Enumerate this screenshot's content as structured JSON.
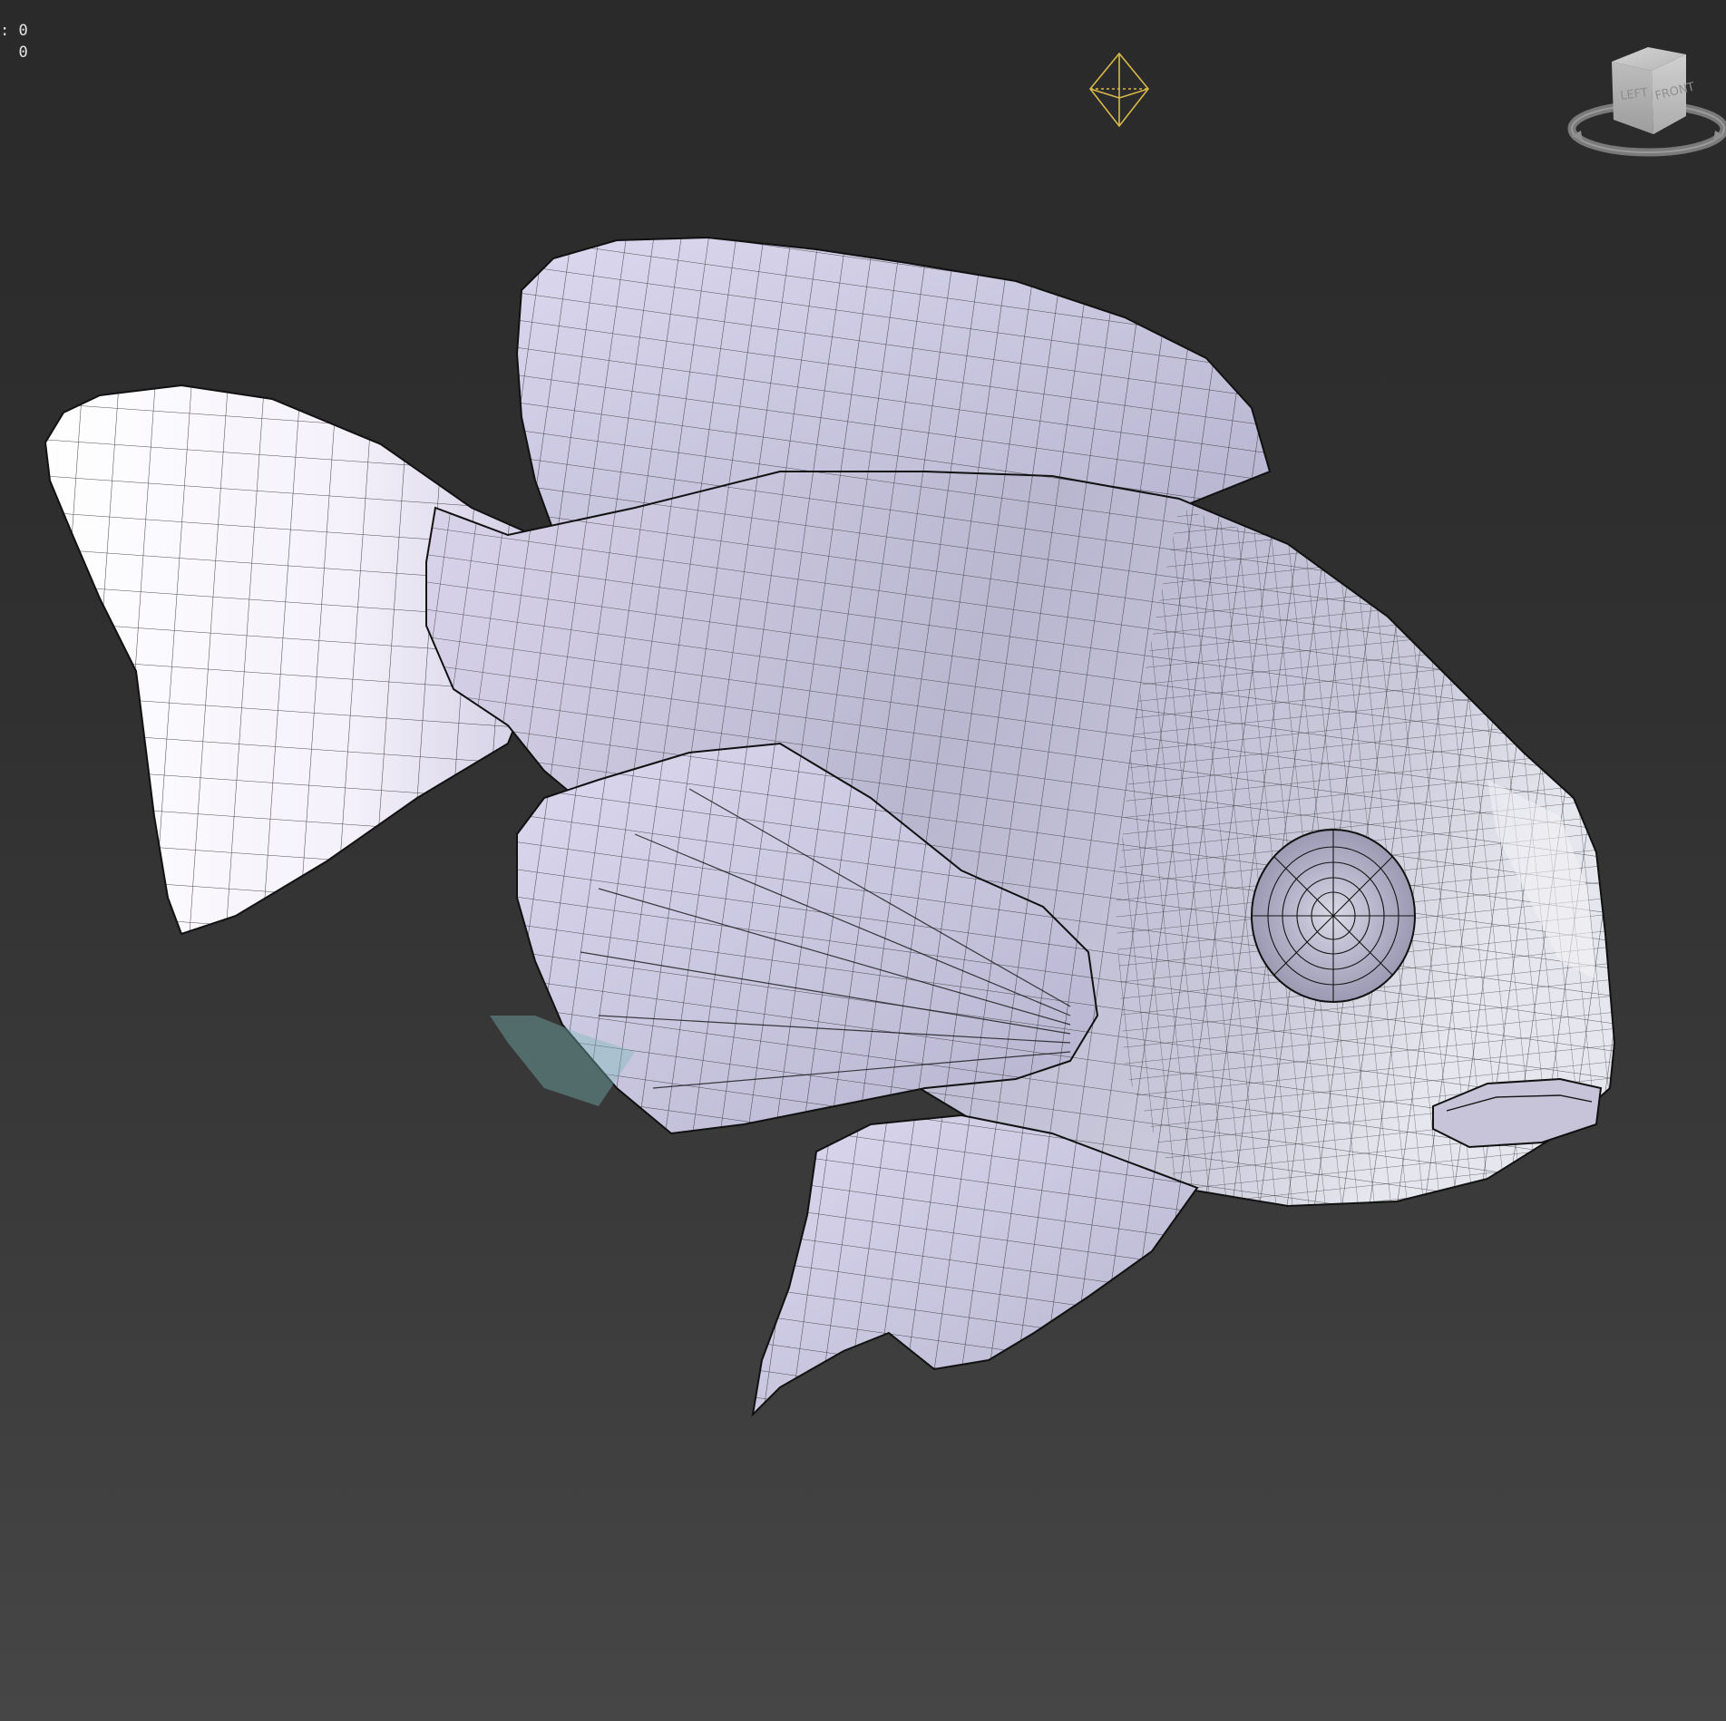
{
  "viewport": {
    "stats": [
      {
        "label": ":",
        "value": "0"
      },
      {
        "label": " ",
        "value": "0"
      }
    ]
  },
  "viewcube": {
    "left_face": "LEFT",
    "front_face": "FRONT"
  },
  "colors": {
    "background_top": "#2a2a2a",
    "background_bottom": "#464646",
    "light_gizmo": "#d8b84a",
    "model_surface": "#c9c6e0",
    "wireframe": "#141414"
  },
  "icons": {
    "light": "octahedron-light-icon",
    "navigation": "viewcube-icon"
  }
}
